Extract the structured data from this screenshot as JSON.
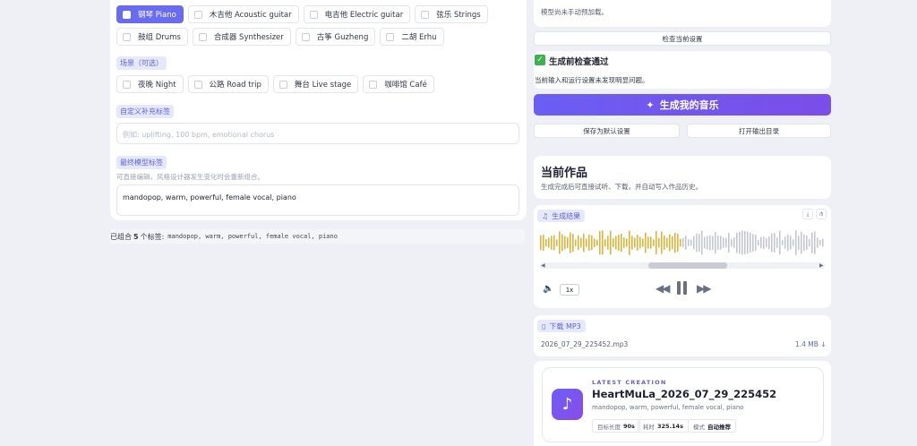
{
  "instruments": {
    "row1": [
      {
        "label": "钢琴 Piano",
        "active": true
      },
      {
        "label": "木吉他 Acoustic guitar",
        "active": false
      },
      {
        "label": "电吉他 Electric guitar",
        "active": false
      },
      {
        "label": "弦乐 Strings",
        "active": false
      }
    ],
    "row2": [
      {
        "label": "鼓组 Drums",
        "active": false
      },
      {
        "label": "合成器 Synthesizer",
        "active": false
      },
      {
        "label": "古筝 Guzheng",
        "active": false
      },
      {
        "label": "二胡 Erhu",
        "active": false
      }
    ]
  },
  "scene": {
    "label": "场景（可选）",
    "options": [
      "夜晚 Night",
      "公路 Road trip",
      "舞台 Live stage",
      "咖啡馆 Café"
    ]
  },
  "custom_tags": {
    "label": "自定义补充标签",
    "placeholder": "例如: uplifting, 100 bpm, emotional chorus"
  },
  "final_tags": {
    "label": "最终模型标签",
    "hint": "可直接编辑，风格设计器发生变化时会重新组合。",
    "value": "mandopop, warm, powerful, female vocal, piano"
  },
  "summary": {
    "prefix": "已组合",
    "count": "5",
    "suffix": "个标签:",
    "tags": "mandopop, warm, powerful, female vocal, piano"
  },
  "right": {
    "model_note": "模型尚未手动预加载。",
    "check_settings": "检查当前设置",
    "precheck_title": "生成前检查通过",
    "precheck_desc": "当前输入和运行设置未发现明显问题。",
    "generate": "生成我的音乐",
    "save_default": "保存为默认设置",
    "open_output": "打开输出目录",
    "current_title": "当前作品",
    "current_desc": "生成完成后可直接试听、下载，并自动写入作品历史。",
    "result_label": "生成结果",
    "speed": "1x",
    "download_label": "下载 MP3",
    "file_name": "2026_07_29_225452.mp3",
    "file_size": "1.4 MB",
    "latest_kicker": "LATEST CREATION",
    "latest_title": "HeartMuLa_2026_07_29_225452",
    "latest_tags": "mandopop, warm, powerful, female vocal, piano",
    "meta": [
      {
        "k": "目标长度",
        "v": "90s"
      },
      {
        "k": "耗时",
        "v": "325.14s"
      },
      {
        "k": "模式",
        "v": "自动推荐"
      }
    ]
  },
  "colors": {
    "accent": "#6a6cf0",
    "wave_played": "#e0b43a",
    "wave_rest": "#c4c7d1"
  }
}
